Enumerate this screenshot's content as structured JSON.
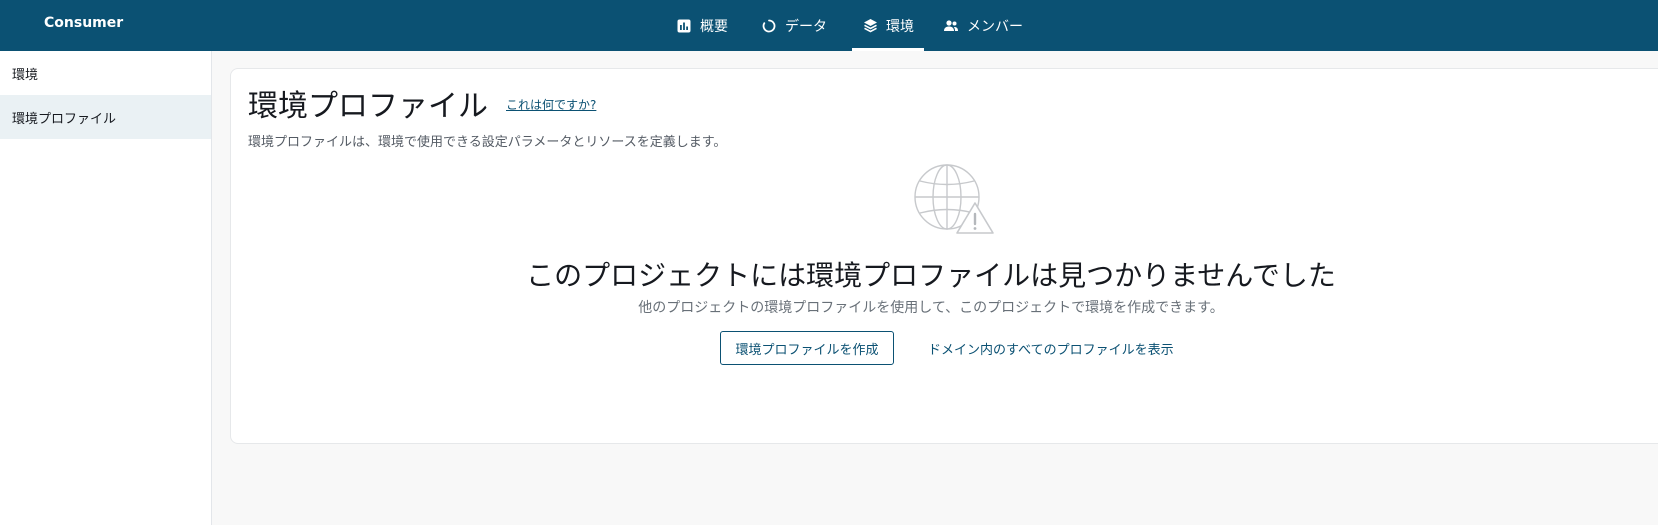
{
  "app": {
    "title": "Consumer"
  },
  "nav": {
    "tabs": [
      {
        "label": "概要",
        "icon": "bar-chart-icon",
        "active": false
      },
      {
        "label": "データ",
        "icon": "circle-icon",
        "active": false
      },
      {
        "label": "環境",
        "icon": "layers-icon",
        "active": true
      },
      {
        "label": "メンバー",
        "icon": "users-icon",
        "active": false
      }
    ]
  },
  "sidebar": {
    "items": [
      {
        "label": "環境",
        "active": false
      },
      {
        "label": "環境プロファイル",
        "active": true
      }
    ]
  },
  "main": {
    "title": "環境プロファイル",
    "info_link": "これは何ですか?",
    "description": "環境プロファイルは、環境で使用できる設定パラメータとリソースを定義します。",
    "empty_state": {
      "icon": "globe-warning-icon",
      "title": "このプロジェクトには環境プロファイルは見つかりませんでした",
      "subtitle": "他のプロジェクトの環境プロファイルを使用して、このプロジェクトで環境を作成できます。",
      "create_button": "環境プロファイルを作成",
      "view_all_link": "ドメイン内のすべてのプロファイルを表示"
    }
  },
  "colors": {
    "header_bg": "#0b5173",
    "accent": "#0b5173",
    "sidebar_active_bg": "#eaf1f4",
    "page_bg": "#f8f8f8"
  }
}
